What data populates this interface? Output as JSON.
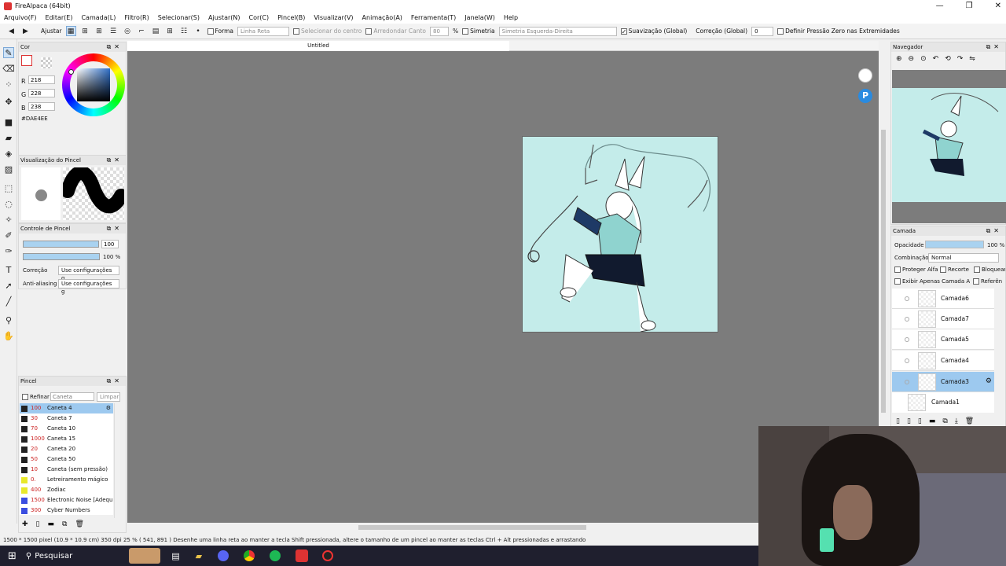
{
  "window": {
    "title": "FireAlpaca (64bit)",
    "min": "—",
    "max": "❐",
    "close": "✕"
  },
  "menu": [
    "Arquivo(F)",
    "Editar(E)",
    "Camada(L)",
    "Filtro(R)",
    "Selecionar(S)",
    "Ajustar(N)",
    "Cor(C)",
    "Pincel(B)",
    "Visualizar(V)",
    "Animação(A)",
    "Ferramenta(T)",
    "Janela(W)",
    "Help"
  ],
  "options": {
    "ajustar": "Ajustar",
    "forma": "Forma",
    "forma_dd": "Linha Reta",
    "selecionar_centro": "Selecionar do centro",
    "arredondar": "Arredondar Canto",
    "arredondar_val": "80",
    "pct": "%",
    "simetria": "Simetria",
    "simetria_dd": "Simetria Esquerda-Direita",
    "suavizacao": "Suavização (Global)",
    "correcao": "Correção (Global)",
    "correcao_val": "0",
    "pressao": "Definir Pressão Zero nas Extremidades"
  },
  "color_panel": {
    "title": "Cor",
    "r_label": "R",
    "r": "218",
    "g_label": "G",
    "g": "228",
    "b_label": "B",
    "b": "238",
    "hex": "#DAE4EE",
    "swatch_color": "#DAE4EE"
  },
  "brush_preview": {
    "title": "Visualização do Pincel"
  },
  "brush_control": {
    "title": "Controle de Pincel",
    "size": "100",
    "opacity": "100 %",
    "correcao_label": "Correção",
    "correcao_dd": "Use configurações g",
    "aa_label": "Anti-aliasing",
    "aa_dd": "Use configurações g"
  },
  "brush_panel": {
    "title": "Pincel",
    "refinar": "Refinar",
    "search_placeholder": "Caneta",
    "limpar": "Limpar",
    "items": [
      {
        "size": "100",
        "name": "Caneta 4",
        "color": "#222222"
      },
      {
        "size": "30",
        "name": "Caneta 7",
        "color": "#222222"
      },
      {
        "size": "70",
        "name": "Caneta 10",
        "color": "#222222"
      },
      {
        "size": "1000",
        "name": "Caneta 15",
        "color": "#222222"
      },
      {
        "size": "20",
        "name": "Caneta 20",
        "color": "#222222"
      },
      {
        "size": "50",
        "name": "Caneta 50",
        "color": "#222222"
      },
      {
        "size": "10",
        "name": "Caneta (sem pressão)",
        "color": "#222222"
      },
      {
        "size": "0.",
        "name": "Letreiramento mágico fi",
        "color": "#e8e82a"
      },
      {
        "size": "400",
        "name": "Zodiac",
        "color": "#e8e82a"
      },
      {
        "size": "1500",
        "name": "Electronic Noise [Adequ",
        "color": "#3a4de0"
      },
      {
        "size": "300",
        "name": "Cyber Numbers",
        "color": "#3a4de0"
      }
    ]
  },
  "document": {
    "tab": "Untitled"
  },
  "navigator": {
    "title": "Navegador"
  },
  "layer_panel": {
    "title": "Camada",
    "opacity_label": "Opacidade",
    "opacity": "100 %",
    "blend_label": "Combinação",
    "blend": "Normal",
    "proteger": "Proteger Alfa",
    "recorte": "Recorte",
    "bloquear": "Bloquear",
    "exibir": "Exibir Apenas Camada Atu",
    "referencia": "Referên",
    "layers": [
      "Camada6",
      "Camada7",
      "Camada5",
      "Camada4",
      "Camada3",
      "Camada1"
    ]
  },
  "status": "1500 * 1500 pixel  (10.9 * 10.9 cm)  350 dpi  25 %  ( 541, 891 )   Desenhe uma linha reta ao manter a tecla Shift pressionada, altere o tamanho de um pincel ao manter as teclas Ctrl + Alt pressionadas e arrastando",
  "taskbar": {
    "search": "Pesquisar"
  }
}
